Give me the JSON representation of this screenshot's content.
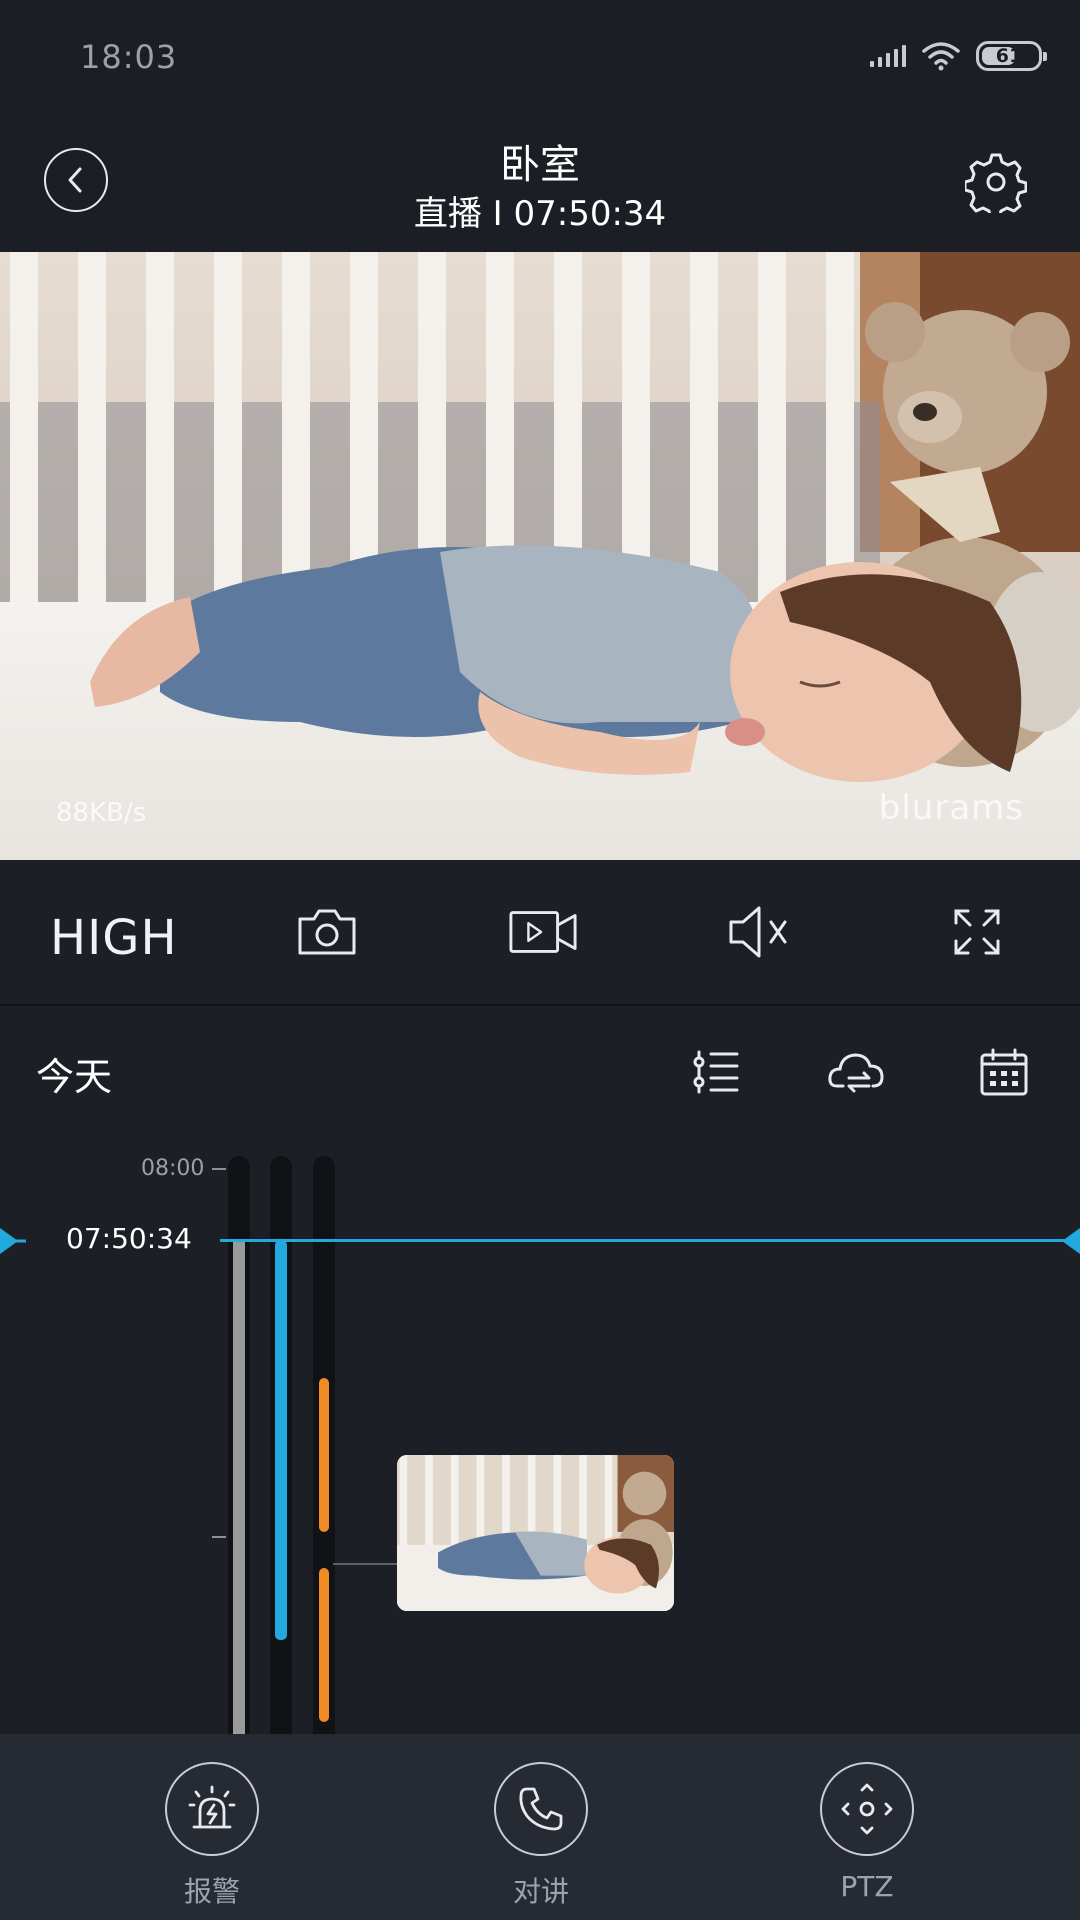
{
  "status_bar": {
    "time": "18:03",
    "battery": "61",
    "battery_level": 0.61
  },
  "header": {
    "title": "卧室",
    "subtitle": "直播 I 07:50:34"
  },
  "video": {
    "bitrate": "88KB/s",
    "watermark": "blurams"
  },
  "controls": {
    "quality": "HIGH"
  },
  "timeline_toolbar": {
    "day": "今天"
  },
  "timeline": {
    "hour_label": "08:00",
    "current_time": "07:50:34"
  },
  "bottom_nav": [
    {
      "label": "报警",
      "icon": "alarm-icon"
    },
    {
      "label": "对讲",
      "icon": "phone-icon"
    },
    {
      "label": "PTZ",
      "icon": "ptz-icon"
    }
  ],
  "colors": {
    "accent": "#22a9de",
    "event": "#f08a24",
    "background": "#1c1f26"
  }
}
